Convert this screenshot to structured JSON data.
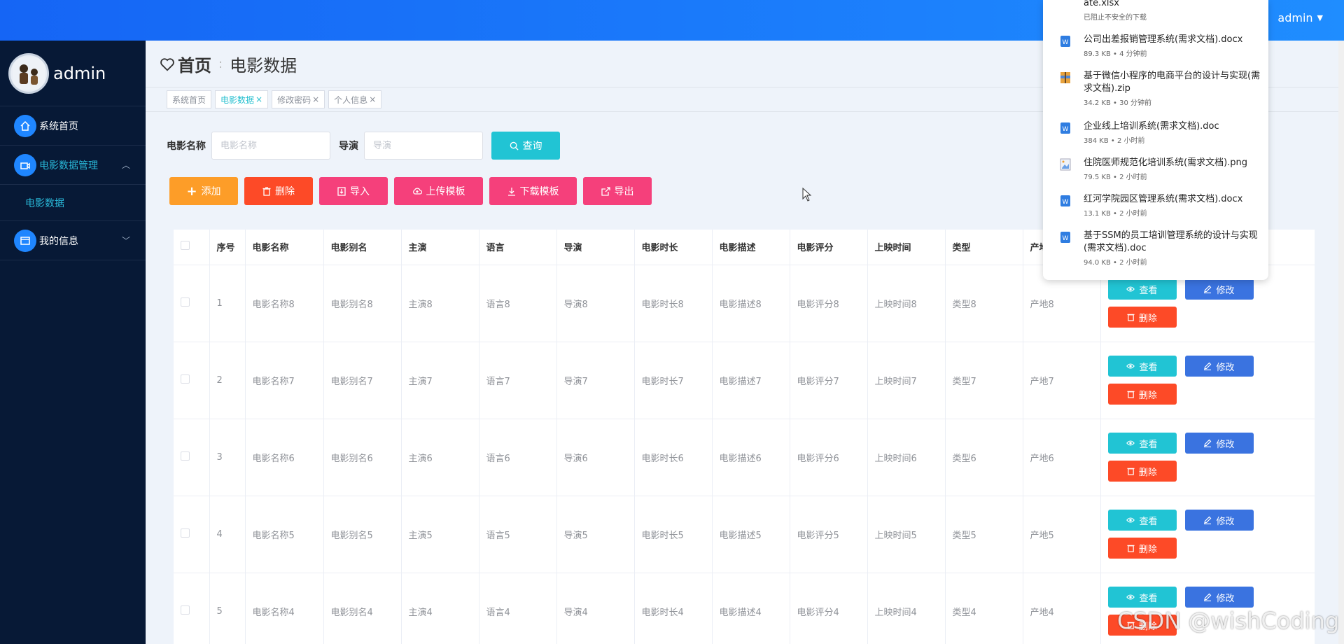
{
  "header": {
    "user": "admin"
  },
  "sidebar": {
    "profile_name": "admin",
    "items": [
      {
        "label": "系统首页"
      },
      {
        "label": "电影数据管理"
      },
      {
        "label": "我的信息"
      }
    ],
    "sub_items": [
      {
        "label": "电影数据"
      }
    ]
  },
  "breadcrumb": {
    "home": "首页",
    "current": "电影数据"
  },
  "tags": [
    {
      "label": "系统首页",
      "closable": ""
    },
    {
      "label": "电影数据",
      "closable": "×"
    },
    {
      "label": "修改密码",
      "closable": "×"
    },
    {
      "label": "个人信息",
      "closable": "×"
    }
  ],
  "search": {
    "name_label": "电影名称",
    "name_placeholder": "电影名称",
    "director_label": "导演",
    "director_placeholder": "导演",
    "query_button": "查询"
  },
  "toolbar": {
    "add": "添加",
    "delete": "删除",
    "import": "导入",
    "upload_template": "上传模板",
    "download_template": "下载模板",
    "export": "导出"
  },
  "table": {
    "columns": [
      "序号",
      "电影名称",
      "电影别名",
      "主演",
      "语言",
      "导演",
      "电影时长",
      "电影描述",
      "电影评分",
      "上映时间",
      "类型",
      "产地"
    ],
    "rows": [
      [
        "1",
        "电影名称8",
        "电影别名8",
        "主演8",
        "语言8",
        "导演8",
        "电影时长8",
        "电影描述8",
        "电影评分8",
        "上映时间8",
        "类型8",
        "产地8"
      ],
      [
        "2",
        "电影名称7",
        "电影别名7",
        "主演7",
        "语言7",
        "导演7",
        "电影时长7",
        "电影描述7",
        "电影评分7",
        "上映时间7",
        "类型7",
        "产地7"
      ],
      [
        "3",
        "电影名称6",
        "电影别名6",
        "主演6",
        "语言6",
        "导演6",
        "电影时长6",
        "电影描述6",
        "电影评分6",
        "上映时间6",
        "类型6",
        "产地6"
      ],
      [
        "4",
        "电影名称5",
        "电影别名5",
        "主演5",
        "语言5",
        "导演5",
        "电影时长5",
        "电影描述5",
        "电影评分5",
        "上映时间5",
        "类型5",
        "产地5"
      ],
      [
        "5",
        "电影名称4",
        "电影别名4",
        "主演4",
        "语言4",
        "导演4",
        "电影时长4",
        "电影描述4",
        "电影评分4",
        "上映时间4",
        "类型4",
        "产地4"
      ]
    ],
    "row_actions": {
      "view": "查看",
      "edit": "修改",
      "delete": "删除"
    }
  },
  "downloads": [
    {
      "name": "ate.xlsx",
      "meta": "已阻止不安全的下载",
      "icon": "file-icon"
    },
    {
      "name": "公司出差报销管理系统(需求文档).docx",
      "meta": "89.3 KB • 4 分钟前",
      "icon": "word-icon"
    },
    {
      "name": "基于微信小程序的电商平台的设计与实现(需求文档).zip",
      "meta": "34.2 KB • 30 分钟前",
      "icon": "zip-icon"
    },
    {
      "name": "企业线上培训系统(需求文档).doc",
      "meta": "384 KB • 2 小时前",
      "icon": "word-icon"
    },
    {
      "name": "住院医师规范化培训系统(需求文档).png",
      "meta": "79.5 KB • 2 小时前",
      "icon": "image-icon"
    },
    {
      "name": "红河学院园区管理系统(需求文档).docx",
      "meta": "13.1 KB • 2 小时前",
      "icon": "word-icon"
    },
    {
      "name": "基于SSM的员工培训管理系统的设计与实现(需求文档).doc",
      "meta": "94.0 KB • 2 小时前",
      "icon": "word-icon"
    }
  ],
  "watermark": "CSDN @wishCoding",
  "colors": {
    "header": "#1565f5",
    "sidebar": "#071936",
    "accent": "#21c4d4",
    "danger": "#fd4a27",
    "warning": "#fd9d28",
    "pink": "#f5407b",
    "edit": "#3a73e0"
  }
}
